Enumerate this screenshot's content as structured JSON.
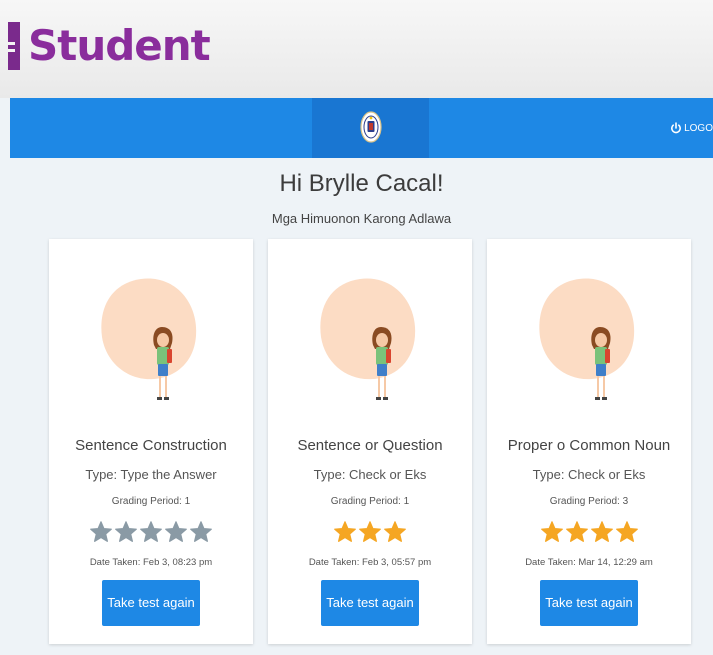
{
  "app": {
    "title": "Student"
  },
  "header": {
    "logout_label": "LOGO",
    "logout_icon": "power-icon",
    "logo_icon": "deped-seal-icon",
    "color": "#1e88e5"
  },
  "main": {
    "greeting": "Hi Brylle Cacal!",
    "subtitle": "Mga Himuonon Karong Adlawa"
  },
  "cards": [
    {
      "name": "Sentence Construction",
      "type": "Type: Type the Answer",
      "period": "Grading Period: 1",
      "stars_filled": 0,
      "stars_empty": 5,
      "date": "Date Taken: Feb 3, 08:23 pm",
      "button": "Take test again"
    },
    {
      "name": "Sentence or Question",
      "type": "Type: Check or Eks",
      "period": "Grading Period: 1",
      "stars_filled": 3,
      "stars_empty": 0,
      "date": "Date Taken: Feb 3, 05:57 pm",
      "button": "Take test again"
    },
    {
      "name": "Proper o Common Noun",
      "type": "Type: Check or Eks",
      "period": "Grading Period: 3",
      "stars_filled": 4,
      "stars_empty": 0,
      "date": "Date Taken: Mar 14, 12:29 am",
      "button": "Take test again"
    }
  ],
  "colors": {
    "title": "#8a2d9c",
    "star_filled": "#f5a623",
    "star_empty": "#8a9aa5",
    "button": "#1e88e5"
  }
}
